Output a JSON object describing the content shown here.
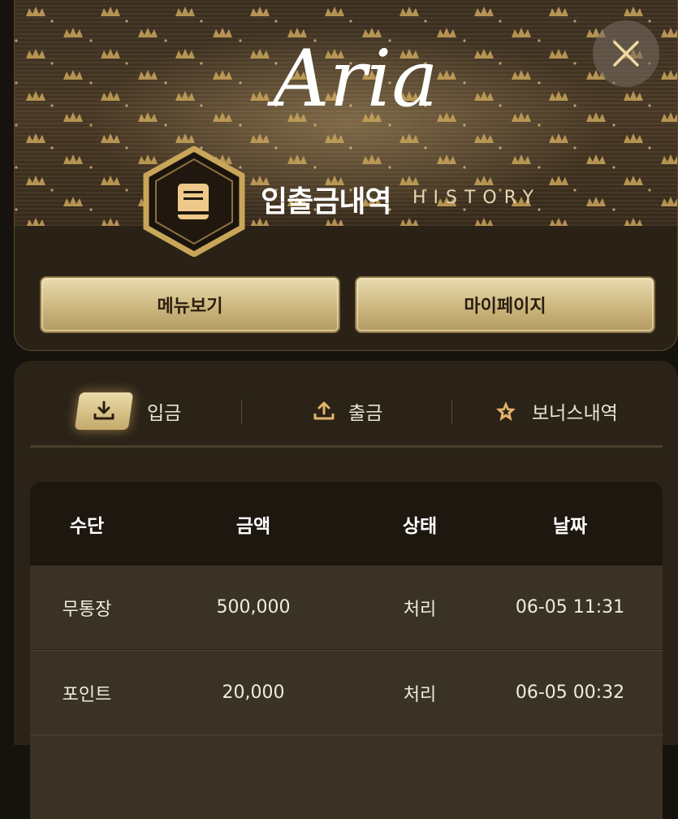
{
  "header": {
    "logo_text": "Aria",
    "title": "입출금내역",
    "title_en": "HISTORY",
    "close_icon": "close-icon",
    "book_icon": "book-icon"
  },
  "buttons": {
    "menu_label": "메뉴보기",
    "mypage_label": "마이페이지"
  },
  "tabs": [
    {
      "label": "입금",
      "icon": "download-icon",
      "active": true
    },
    {
      "label": "출금",
      "icon": "upload-icon",
      "active": false
    },
    {
      "label": "보너스내역",
      "icon": "star-icon",
      "active": false
    }
  ],
  "table": {
    "headers": [
      "수단",
      "금액",
      "상태",
      "날짜"
    ],
    "rows": [
      [
        "무통장",
        "500,000",
        "처리",
        "06-05 11:31"
      ],
      [
        "포인트",
        "20,000",
        "처리",
        "06-05 00:32"
      ]
    ]
  },
  "colors": {
    "accent_gold": "#c9b37a",
    "background": "#16120d",
    "panel": "#2b2317"
  }
}
